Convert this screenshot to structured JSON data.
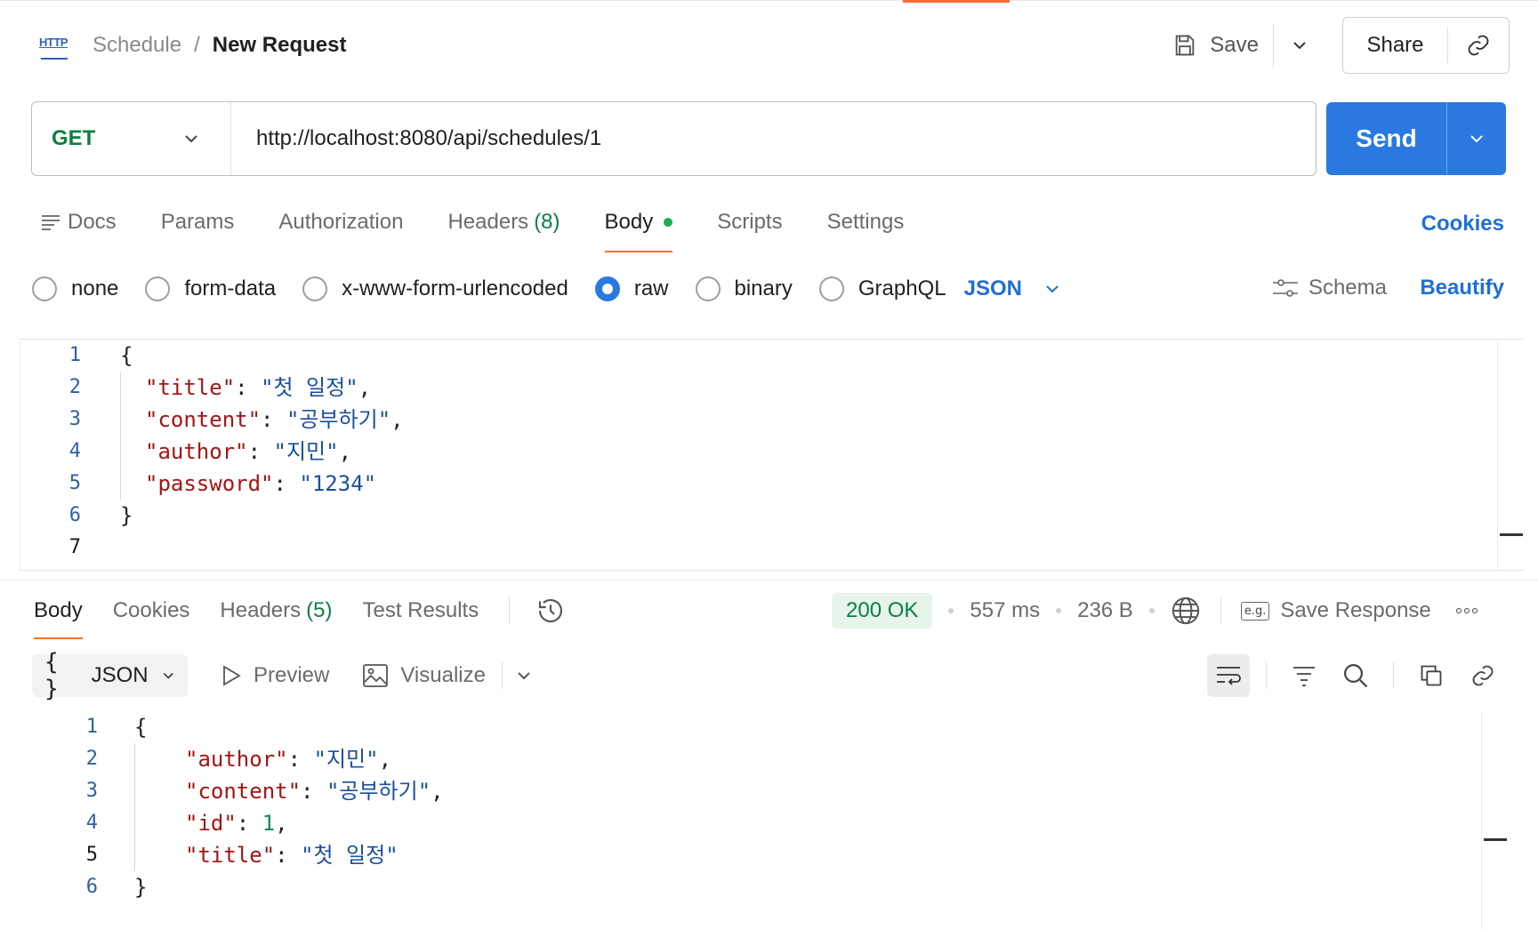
{
  "header": {
    "breadcrumb_parent": "Schedule",
    "breadcrumb_sep": "/",
    "breadcrumb_current": "New Request",
    "http_icon_text": "HTTP",
    "save_label": "Save",
    "share_label": "Share"
  },
  "request": {
    "method": "GET",
    "url": "http://localhost:8080/api/schedules/1",
    "send_label": "Send"
  },
  "req_tabs": {
    "docs": "Docs",
    "params": "Params",
    "authorization": "Authorization",
    "headers": "Headers",
    "headers_count": "(8)",
    "body": "Body",
    "scripts": "Scripts",
    "settings": "Settings",
    "cookies": "Cookies"
  },
  "body_types": {
    "none": "none",
    "form_data": "form-data",
    "urlencoded": "x-www-form-urlencoded",
    "raw": "raw",
    "binary": "binary",
    "graphql": "GraphQL",
    "language": "JSON",
    "schema": "Schema",
    "beautify": "Beautify"
  },
  "request_body": {
    "line_numbers": [
      "1",
      "2",
      "3",
      "4",
      "5",
      "6",
      "7"
    ],
    "open": "{",
    "close": "}",
    "fields": [
      {
        "key": "\"title\"",
        "value": "\"첫 일정\"",
        "comma": ","
      },
      {
        "key": "\"content\"",
        "value": "\"공부하기\"",
        "comma": ","
      },
      {
        "key": "\"author\"",
        "value": "\"지민\"",
        "comma": ","
      },
      {
        "key": "\"password\"",
        "value": "\"1234\"",
        "comma": ""
      }
    ]
  },
  "resp_tabs": {
    "body": "Body",
    "cookies": "Cookies",
    "headers": "Headers",
    "headers_count": "(5)",
    "test_results": "Test Results"
  },
  "resp_meta": {
    "status": "200 OK",
    "time": "557 ms",
    "size": "236 B",
    "save_response": "Save Response",
    "eg": "e.g."
  },
  "resp_toolbar": {
    "format": "JSON",
    "braces": "{ }",
    "preview": "Preview",
    "visualize": "Visualize"
  },
  "response_body": {
    "line_numbers": [
      "1",
      "2",
      "3",
      "4",
      "5",
      "6"
    ],
    "open": "{",
    "close": "}",
    "fields": [
      {
        "key": "\"author\"",
        "value": "\"지민\"",
        "comma": ","
      },
      {
        "key": "\"content\"",
        "value": "\"공부하기\"",
        "comma": ","
      },
      {
        "key": "\"id\"",
        "value": "1",
        "comma": ","
      },
      {
        "key": "\"title\"",
        "value": "\"첫 일정\"",
        "comma": ""
      }
    ]
  },
  "colors": {
    "accent": "#ff6c37",
    "send": "#2979e0",
    "link": "#1f6fd6",
    "method_get": "#0b8043",
    "status_ok": "#0b8043"
  }
}
